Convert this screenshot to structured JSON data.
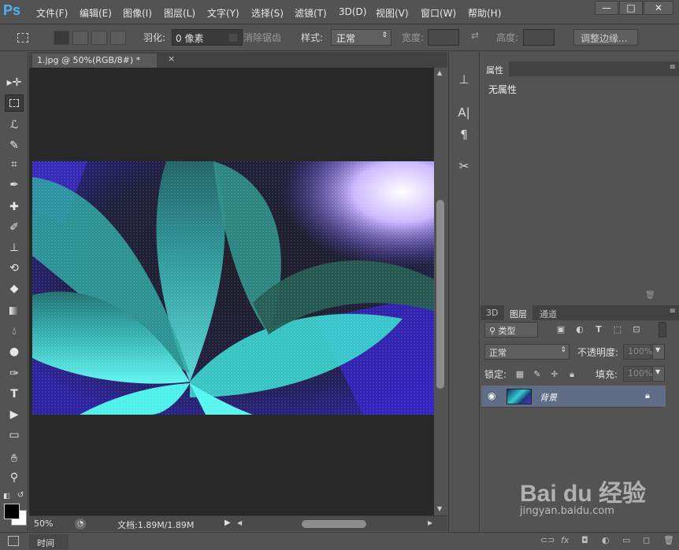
{
  "app": {
    "logo": "Ps",
    "menu": [
      "文件(F)",
      "编辑(E)",
      "图像(I)",
      "图层(L)",
      "文字(Y)",
      "选择(S)",
      "滤镜(T)",
      "3D(D)",
      "视图(V)",
      "窗口(W)",
      "帮助(H)"
    ],
    "window_controls": {
      "minimize": "—",
      "maximize": "□",
      "close": "✕"
    }
  },
  "options_bar": {
    "feather_label": "羽化:",
    "feather_value": "0 像素",
    "antialias_label": "消除锯齿",
    "style_label": "样式:",
    "style_value": "正常",
    "width_label": "宽度:",
    "height_label": "高度:",
    "refine_edge_button": "调整边缘..."
  },
  "document": {
    "tab_title": "1.jpg @ 50%(RGB/8#) *",
    "tab_close": "×",
    "zoom": "50%",
    "doc_info": "文档:1.89M/1.89M"
  },
  "timeline": {
    "label": "时间轴"
  },
  "properties_panel": {
    "tab_label": "属性",
    "content": "无属性"
  },
  "layers_panel": {
    "tabs": [
      "3D",
      "图层",
      "通道"
    ],
    "active_tab": "图层",
    "filter_kind": "类型",
    "blend_mode": "正常",
    "opacity_label": "不透明度:",
    "opacity_value": "100%",
    "lock_label": "锁定:",
    "fill_label": "填充:",
    "fill_value": "100%",
    "layers": [
      {
        "name": "背景",
        "visible": true,
        "locked": true
      }
    ]
  },
  "watermark": {
    "main": "Bai du 经验",
    "sub": "jingyan.baidu.com"
  },
  "colors": {
    "ui_bg": "#535353",
    "canvas_bg": "#282828",
    "selected_layer": "#5f6e86",
    "logo_blue": "#4fb4f5"
  },
  "icons": [
    "move-icon",
    "marquee-icon",
    "lasso-icon",
    "quick-select-icon",
    "crop-icon",
    "eyedropper-icon",
    "healing-brush-icon",
    "brush-icon",
    "clone-stamp-icon",
    "history-brush-icon",
    "eraser-icon",
    "gradient-icon",
    "blur-icon",
    "dodge-icon",
    "pen-icon",
    "type-icon",
    "path-select-icon",
    "rectangle-icon",
    "hand-icon",
    "zoom-icon"
  ]
}
